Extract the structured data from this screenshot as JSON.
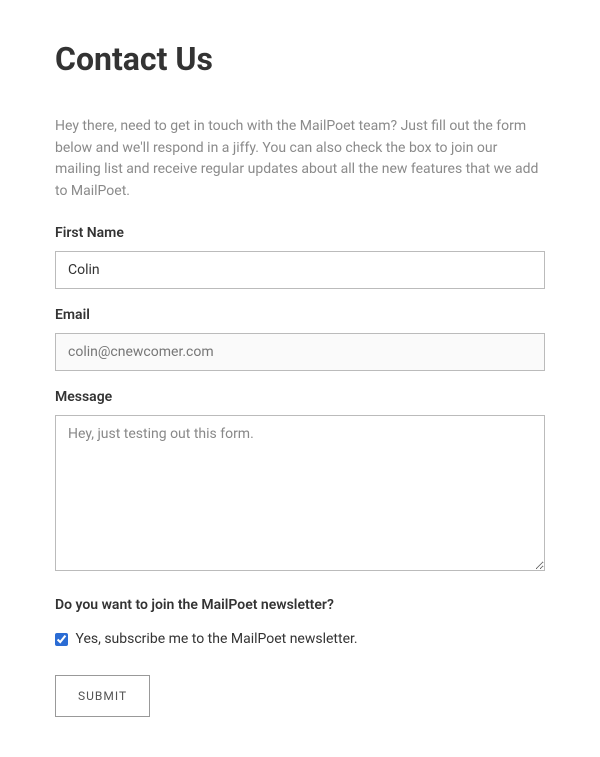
{
  "heading": "Contact Us",
  "intro": "Hey there, need to get in touch with the MailPoet team? Just fill out the form below and we'll respond in a jiffy. You can also check the box to join our mailing list and receive regular updates about all the new features that we add to MailPoet.",
  "form": {
    "first_name": {
      "label": "First Name",
      "value": "Colin"
    },
    "email": {
      "label": "Email",
      "value": "colin@cnewcomer.com"
    },
    "message": {
      "label": "Message",
      "value": "Hey, just testing out this form."
    },
    "newsletter_question": "Do you want to join the MailPoet newsletter?",
    "newsletter_checkbox": {
      "label": "Yes, subscribe me to the MailPoet newsletter.",
      "checked": true
    },
    "submit_label": "SUBMIT"
  }
}
